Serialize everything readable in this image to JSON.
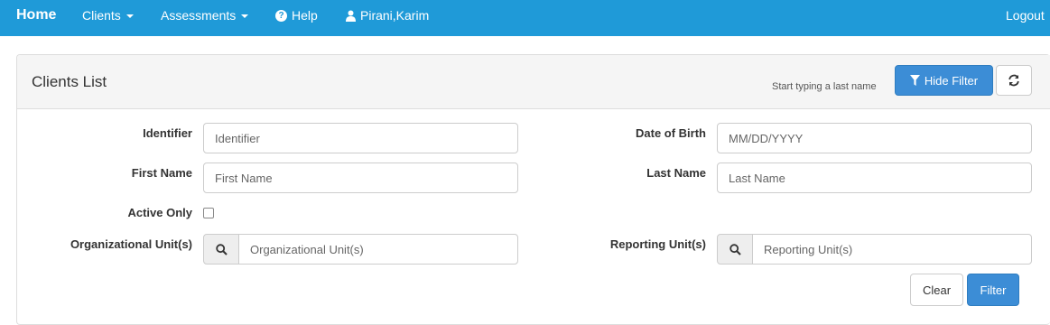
{
  "nav": {
    "brand": "Home",
    "clients": "Clients",
    "assessments": "Assessments",
    "help": "Help",
    "user": "Pirani,Karim",
    "logout": "Logout"
  },
  "panel": {
    "title": "Clients List",
    "hint": "Start typing a last name",
    "hide_filter_label": "Hide Filter"
  },
  "filters": {
    "identifier": {
      "label": "Identifier",
      "placeholder": "Identifier",
      "value": ""
    },
    "first_name": {
      "label": "First Name",
      "placeholder": "First Name",
      "value": ""
    },
    "active_only": {
      "label": "Active Only",
      "checked": false
    },
    "org_unit": {
      "label": "Organizational Unit(s)",
      "placeholder": "Organizational Unit(s)",
      "value": ""
    },
    "dob": {
      "label": "Date of Birth",
      "placeholder": "MM/DD/YYYY",
      "value": ""
    },
    "last_name": {
      "label": "Last Name",
      "placeholder": "Last Name",
      "value": ""
    },
    "reporting_unit": {
      "label": "Reporting Unit(s)",
      "placeholder": "Reporting Unit(s)",
      "value": ""
    }
  },
  "actions": {
    "clear": "Clear",
    "filter": "Filter"
  },
  "icons": {
    "help": "question-circle-icon",
    "user": "user-icon",
    "filter": "filter-icon",
    "refresh": "refresh-icon",
    "search": "search-icon"
  },
  "colors": {
    "navbar": "#1f9ad8",
    "primary_button": "#3c8dd6"
  }
}
